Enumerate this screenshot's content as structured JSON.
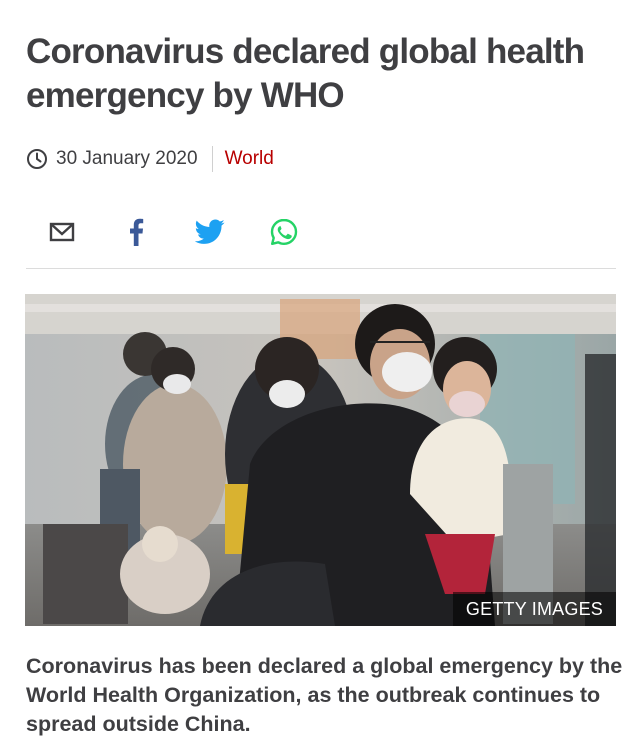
{
  "article": {
    "headline": "Coronavirus declared global health emergency by WHO",
    "date": "30 January 2020",
    "section": "World",
    "section_color": "#b80000",
    "summary": "Coronavirus has been declared a global emergency by the World Health Organization, as the outbreak continues to spread outside China."
  },
  "share": {
    "icons": [
      "email-icon",
      "facebook-icon",
      "twitter-icon",
      "whatsapp-icon"
    ],
    "colors": {
      "email": "#3f3f42",
      "facebook": "#3b5998",
      "twitter": "#1da1f2",
      "whatsapp": "#25d366"
    }
  },
  "image": {
    "credit": "GETTY IMAGES"
  }
}
